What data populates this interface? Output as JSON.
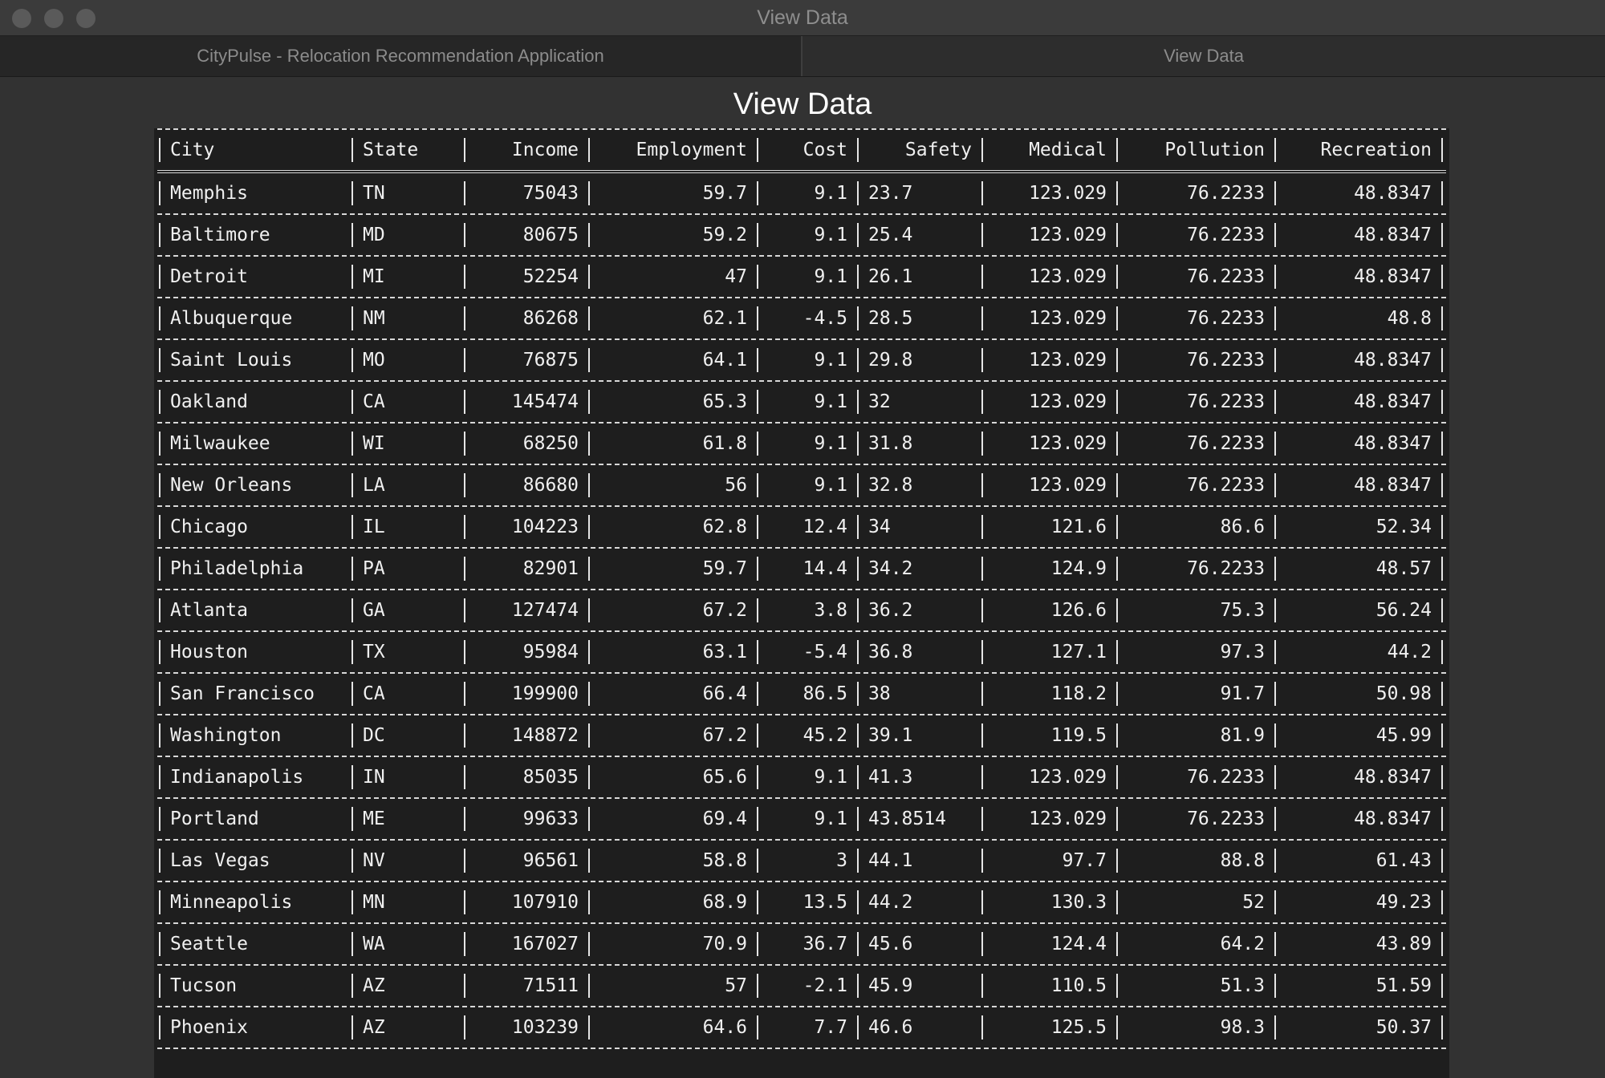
{
  "window": {
    "title": "View Data"
  },
  "tabs": [
    {
      "label": "CityPulse - Relocation Recommendation Application"
    },
    {
      "label": "View Data"
    }
  ],
  "page": {
    "title": "View Data"
  },
  "table": {
    "columns": [
      "City",
      "State",
      "Income",
      "Employment",
      "Cost",
      "Safety",
      "Medical",
      "Pollution",
      "Recreation"
    ],
    "rows": [
      [
        "Memphis",
        "TN",
        "75043",
        "59.7",
        "9.1",
        "23.7",
        "123.029",
        "76.2233",
        "48.8347"
      ],
      [
        "Baltimore",
        "MD",
        "80675",
        "59.2",
        "9.1",
        "25.4",
        "123.029",
        "76.2233",
        "48.8347"
      ],
      [
        "Detroit",
        "MI",
        "52254",
        "47",
        "9.1",
        "26.1",
        "123.029",
        "76.2233",
        "48.8347"
      ],
      [
        "Albuquerque",
        "NM",
        "86268",
        "62.1",
        "-4.5",
        "28.5",
        "123.029",
        "76.2233",
        "48.8"
      ],
      [
        "Saint Louis",
        "MO",
        "76875",
        "64.1",
        "9.1",
        "29.8",
        "123.029",
        "76.2233",
        "48.8347"
      ],
      [
        "Oakland",
        "CA",
        "145474",
        "65.3",
        "9.1",
        "32",
        "123.029",
        "76.2233",
        "48.8347"
      ],
      [
        "Milwaukee",
        "WI",
        "68250",
        "61.8",
        "9.1",
        "31.8",
        "123.029",
        "76.2233",
        "48.8347"
      ],
      [
        "New Orleans",
        "LA",
        "86680",
        "56",
        "9.1",
        "32.8",
        "123.029",
        "76.2233",
        "48.8347"
      ],
      [
        "Chicago",
        "IL",
        "104223",
        "62.8",
        "12.4",
        "34",
        "121.6",
        "86.6",
        "52.34"
      ],
      [
        "Philadelphia",
        "PA",
        "82901",
        "59.7",
        "14.4",
        "34.2",
        "124.9",
        "76.2233",
        "48.57"
      ],
      [
        "Atlanta",
        "GA",
        "127474",
        "67.2",
        "3.8",
        "36.2",
        "126.6",
        "75.3",
        "56.24"
      ],
      [
        "Houston",
        "TX",
        "95984",
        "63.1",
        "-5.4",
        "36.8",
        "127.1",
        "97.3",
        "44.2"
      ],
      [
        "San Francisco",
        "CA",
        "199900",
        "66.4",
        "86.5",
        "38",
        "118.2",
        "91.7",
        "50.98"
      ],
      [
        "Washington",
        "DC",
        "148872",
        "67.2",
        "45.2",
        "39.1",
        "119.5",
        "81.9",
        "45.99"
      ],
      [
        "Indianapolis",
        "IN",
        "85035",
        "65.6",
        "9.1",
        "41.3",
        "123.029",
        "76.2233",
        "48.8347"
      ],
      [
        "Portland",
        "ME",
        "99633",
        "69.4",
        "9.1",
        "43.8514",
        "123.029",
        "76.2233",
        "48.8347"
      ],
      [
        "Las Vegas",
        "NV",
        "96561",
        "58.8",
        "3",
        "44.1",
        "97.7",
        "88.8",
        "61.43"
      ],
      [
        "Minneapolis",
        "MN",
        "107910",
        "68.9",
        "13.5",
        "44.2",
        "130.3",
        "52",
        "49.23"
      ],
      [
        "Seattle",
        "WA",
        "167027",
        "70.9",
        "36.7",
        "45.6",
        "124.4",
        "64.2",
        "43.89"
      ],
      [
        "Tucson",
        "AZ",
        "71511",
        "57",
        "-2.1",
        "45.9",
        "110.5",
        "51.3",
        "51.59"
      ],
      [
        "Phoenix",
        "AZ",
        "103239",
        "64.6",
        "7.7",
        "46.6",
        "125.5",
        "98.3",
        "50.37"
      ]
    ]
  }
}
